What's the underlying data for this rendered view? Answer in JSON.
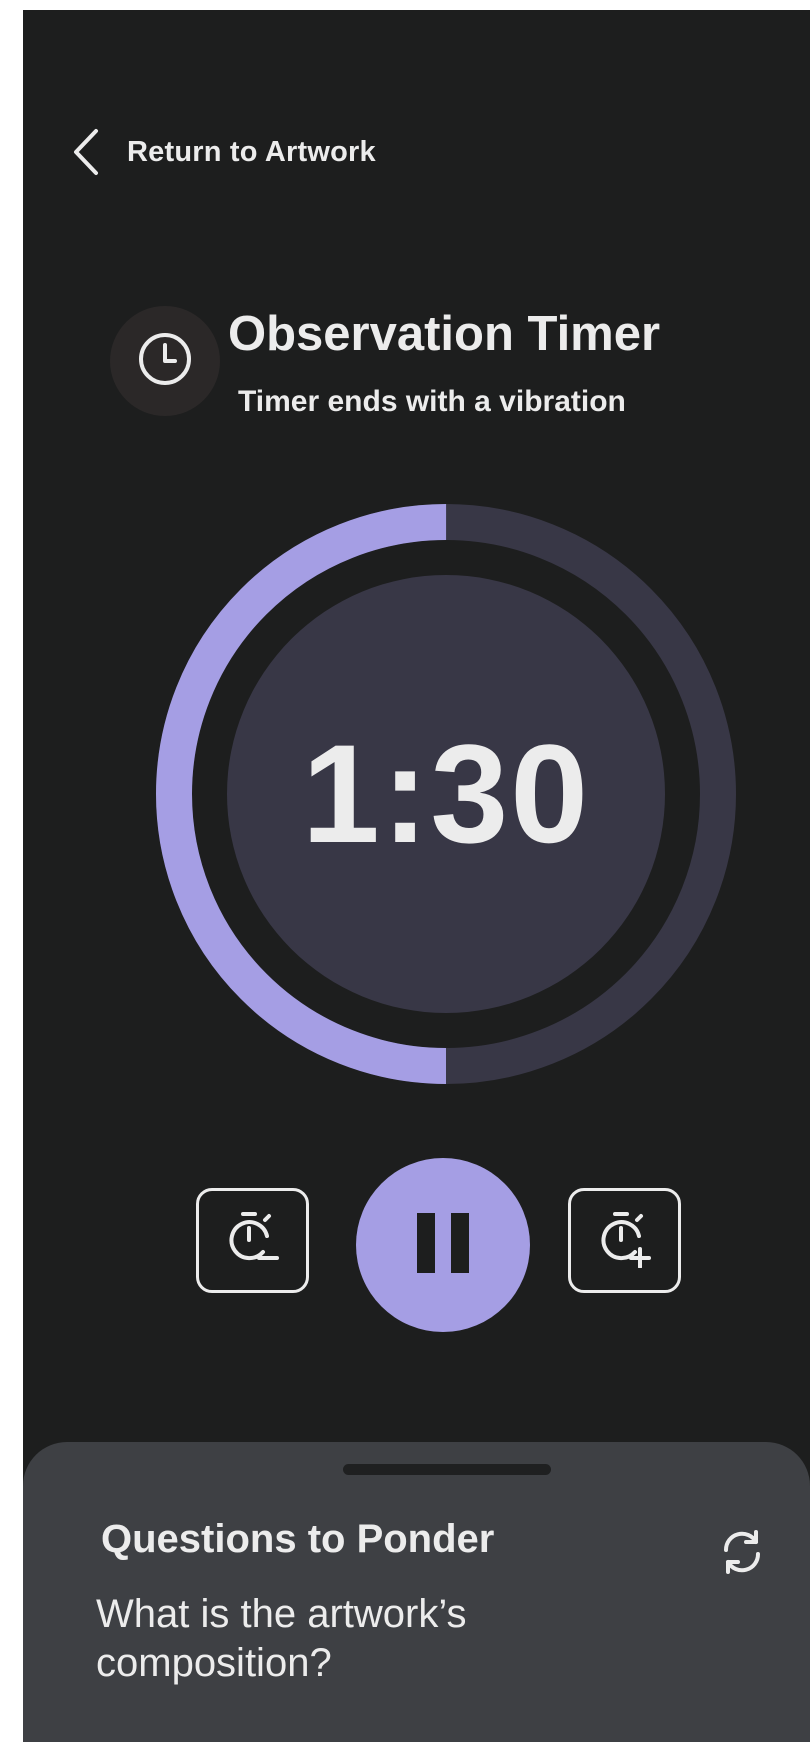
{
  "header": {
    "back_label": "Return to Artwork"
  },
  "title_section": {
    "title": "Observation Timer",
    "subtitle": "Timer ends with a vibration",
    "icon": "clock-icon"
  },
  "timer": {
    "display": "1:30",
    "progress_fraction": 0.5
  },
  "controls": {
    "decrease_icon": "timer-minus-icon",
    "pause_icon": "pause-icon",
    "increase_icon": "timer-plus-icon"
  },
  "sheet": {
    "title": "Questions to Ponder",
    "question": "What is the artwork’s composition?",
    "refresh_icon": "refresh-icon"
  },
  "colors": {
    "background": "#1d1e1e",
    "accent": "#a59ee4",
    "ring_track": "#383746",
    "sheet": "#3e4044",
    "text": "#ececec"
  }
}
